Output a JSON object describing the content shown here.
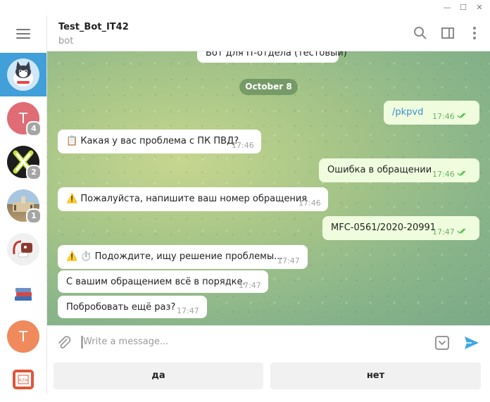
{
  "window": {
    "minimize_glyph": "—",
    "maximize_glyph": "☐",
    "close_glyph": "✕"
  },
  "sidebar": {
    "chats": [
      {
        "initial": "",
        "badge": "",
        "color": "#419fd9"
      },
      {
        "initial": "T",
        "badge": "4",
        "color": "#e06c75"
      },
      {
        "initial": "",
        "badge": "2",
        "color": "#1d1d1d"
      },
      {
        "initial": "",
        "badge": "1",
        "color": "#7a9cb8"
      },
      {
        "initial": "",
        "badge": "",
        "color": "#f0f0f0"
      },
      {
        "initial": "",
        "badge": "",
        "color": "#ffffff"
      },
      {
        "initial": "T",
        "badge": "",
        "color": "#f08a5d"
      },
      {
        "initial": "",
        "badge": "",
        "color": "#ffffff"
      }
    ]
  },
  "header": {
    "title": "Test_Bot_IT42",
    "subtitle": "bot"
  },
  "messages": {
    "prev_partial": "Бот для IT-отдела (тестовый)",
    "date": "October 8",
    "m1": {
      "text": "/pkpvd",
      "time": "17:46"
    },
    "m2": {
      "icon": "📋",
      "text": "Какая у вас проблема с ПК ПВД?",
      "time": "17:46"
    },
    "m3": {
      "text": "Ошибка в обращении",
      "time": "17:46"
    },
    "m4": {
      "icon": "⚠️",
      "text": "Пожалуйста, напишите ваш номер обращения",
      "time": "17:46"
    },
    "m5": {
      "text": "MFC-0561/2020-20991",
      "time": "17:47"
    },
    "m6": {
      "icon": "⚠️ ⏱️",
      "text": "Подождите, ищу решение проблемы...",
      "time": "17:47"
    },
    "m7": {
      "text": "С вашим обращением всё в порядке.",
      "time": "17:47"
    },
    "m8": {
      "text": "Побробовать ещё раз?",
      "time": "17:47"
    }
  },
  "composer": {
    "placeholder": "Write a message..."
  },
  "keyboard": {
    "yes_label": "да",
    "no_label": "нет"
  },
  "colors": {
    "accent": "#419fd9",
    "outgoing": "#effdde",
    "send": "#40a7e3"
  }
}
